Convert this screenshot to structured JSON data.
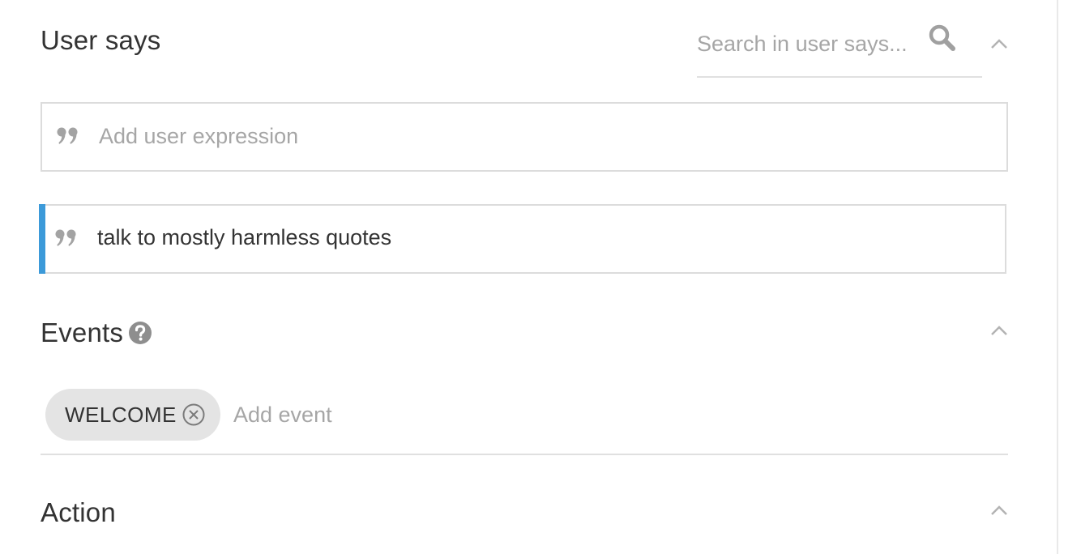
{
  "user_says": {
    "title": "User says",
    "search": {
      "placeholder": "Search in user says...",
      "value": ""
    },
    "collapse_icon": "chevron-up-icon",
    "new_expression": {
      "icon": "quote-icon",
      "placeholder": "Add user expression",
      "value": ""
    },
    "expressions": [
      {
        "icon": "quote-icon",
        "text": "talk to mostly harmless quotes"
      }
    ],
    "active_accent_color": "#3c9ad9"
  },
  "events": {
    "title": "Events",
    "help_icon": "question-circle-icon",
    "collapse_icon": "chevron-up-icon",
    "chips": [
      {
        "label": "WELCOME",
        "remove_icon": "circle-x-icon"
      }
    ],
    "add_event": {
      "placeholder": "Add event",
      "value": ""
    }
  },
  "action": {
    "title": "Action",
    "collapse_icon": "chevron-up-icon"
  }
}
